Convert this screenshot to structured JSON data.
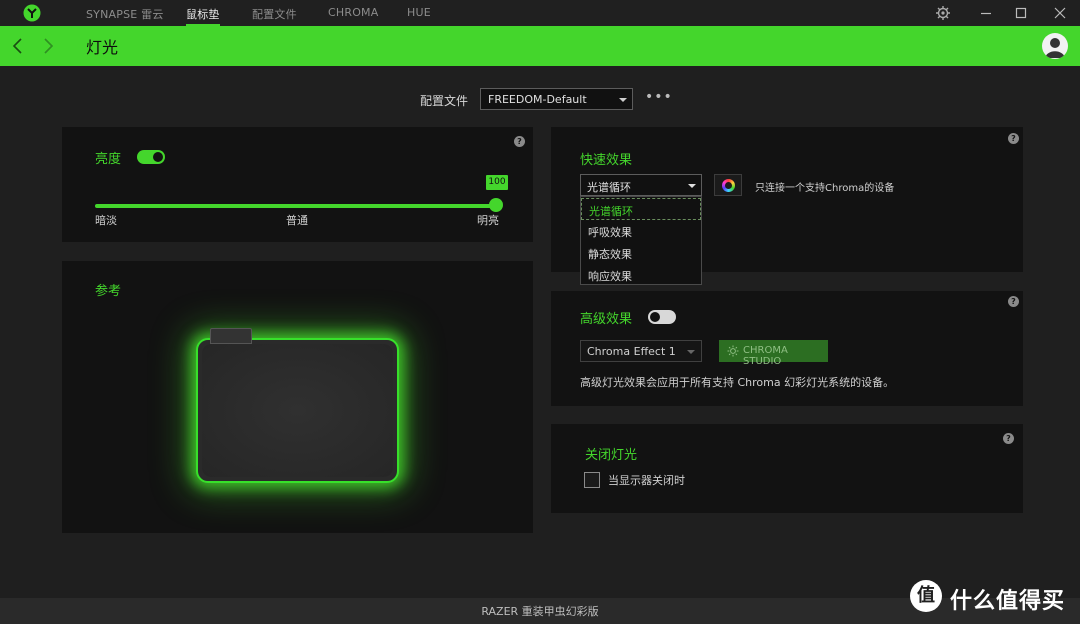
{
  "titlebar": {
    "tabs": [
      "SYNAPSE 雷云",
      "鼠标垫",
      "配置文件",
      "CHROMA",
      "HUE"
    ],
    "active_tab": "鼠标垫"
  },
  "header": {
    "title": "灯光"
  },
  "profile": {
    "label": "配置文件",
    "value": "FREEDOM-Default",
    "more": "•••"
  },
  "brightness": {
    "label": "亮度",
    "enabled": true,
    "value": "100",
    "min_label": "暗淡",
    "mid_label": "普通",
    "max_label": "明亮"
  },
  "reference": {
    "label": "参考"
  },
  "quick_effect": {
    "label": "快速效果",
    "selected": "光谱循环",
    "options": [
      "光谱循环",
      "呼吸效果",
      "静态效果",
      "响应效果"
    ],
    "note": "只连接一个支持Chroma的设备"
  },
  "advanced_effect": {
    "label": "高级效果",
    "enabled": false,
    "select_value": "Chroma Effect 1",
    "studio_button": "CHROMA STUDIO",
    "description": "高级灯光效果会应用于所有支持 Chroma 幻彩灯光系统的设备。"
  },
  "lights_off": {
    "label": "关闭灯光",
    "checkbox_label": "当显示器关闭时",
    "checked": false
  },
  "footer": {
    "device": "RAZER 重装甲虫幻彩版"
  },
  "watermark": {
    "symbol": "值",
    "text": "什么值得买"
  },
  "help": "?",
  "colors": {
    "accent": "#44d62c",
    "panel": "#121212",
    "background": "#1f1f1f"
  }
}
